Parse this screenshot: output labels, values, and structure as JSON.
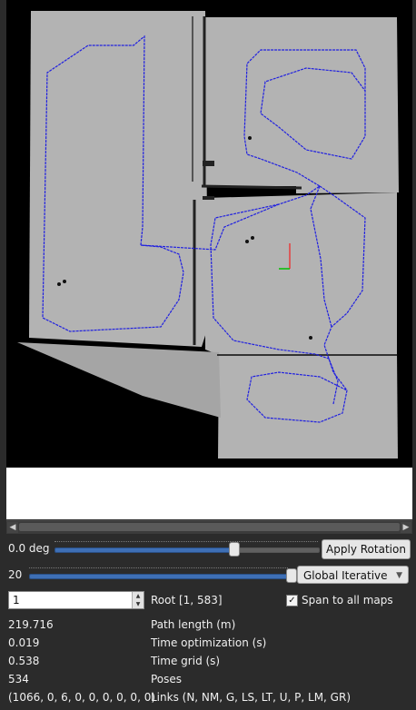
{
  "rotation": {
    "value_label": "0.0 deg",
    "slider_fraction": 0.68,
    "apply_label": "Apply Rotation"
  },
  "iterations": {
    "value_label": "20",
    "slider_fraction": 1.0,
    "mode_label": "Global Iterative"
  },
  "root": {
    "spin_value": "1",
    "label": "Root [1, 583]",
    "span_label": "Span to all maps",
    "span_checked": true
  },
  "stats": [
    {
      "value": "219.716",
      "label": "Path length (m)"
    },
    {
      "value": "0.019",
      "label": "Time optimization (s)"
    },
    {
      "value": "0.538",
      "label": "Time grid (s)"
    },
    {
      "value": "534",
      "label": "Poses"
    },
    {
      "value": "(1066, 0, 6, 0, 0, 0, 0, 0, 0)",
      "label": "Links (N, NM, G, LS, LT, U, P, LM, GR)"
    }
  ],
  "colors": {
    "map_free": "#b3b3b3",
    "map_unknown": "#000000",
    "path": "#2020e0",
    "slider_fill": "#3e6fb5"
  }
}
